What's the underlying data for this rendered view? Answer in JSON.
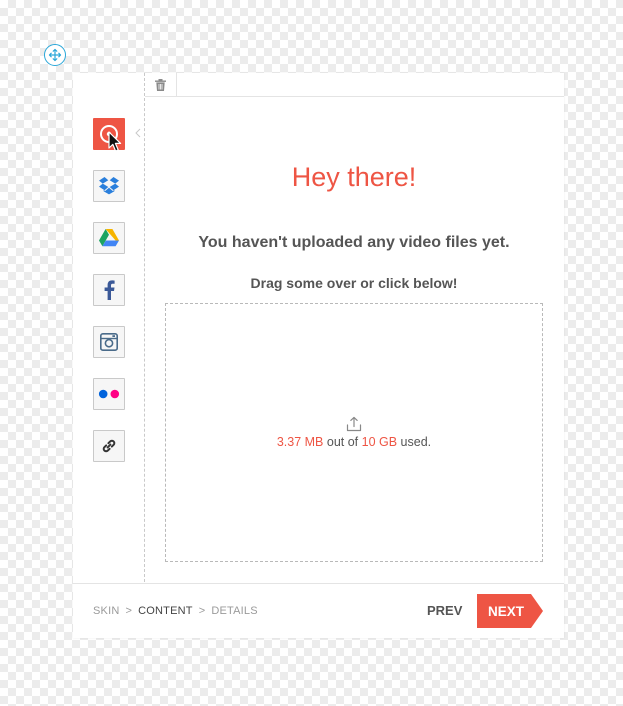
{
  "colors": {
    "accent": "#ee5544",
    "dropbox": "#2a7fdc",
    "facebook": "#3b5998",
    "instagram": "#4a6b8a",
    "flickr_blue": "#0063dc",
    "flickr_pink": "#ff0084",
    "move_handle": "#2aa7d9"
  },
  "toolbar": {
    "move_icon": "move-arrows-icon",
    "delete_icon": "trash-icon"
  },
  "sources": [
    {
      "id": "local",
      "icon": "upload-disc-icon",
      "active": true
    },
    {
      "id": "dropbox",
      "icon": "dropbox-icon"
    },
    {
      "id": "google-drive",
      "icon": "google-drive-icon"
    },
    {
      "id": "facebook",
      "icon": "facebook-icon"
    },
    {
      "id": "instagram",
      "icon": "instagram-icon"
    },
    {
      "id": "flickr",
      "icon": "flickr-icon"
    },
    {
      "id": "link",
      "icon": "link-icon"
    }
  ],
  "main": {
    "greeting": "Hey there!",
    "empty_message": "You haven't uploaded any video files yet.",
    "instruction": "Drag some over or click below!",
    "upload_icon": "upload-icon",
    "usage": {
      "used": "3.37 MB",
      "middle": " out of ",
      "total": "10 GB",
      "suffix": " used."
    }
  },
  "footer": {
    "breadcrumbs": [
      {
        "label": "SKIN",
        "current": false
      },
      {
        "label": "CONTENT",
        "current": true
      },
      {
        "label": "DETAILS",
        "current": false
      }
    ],
    "separator": ">",
    "prev_label": "PREV",
    "next_label": "NEXT"
  }
}
